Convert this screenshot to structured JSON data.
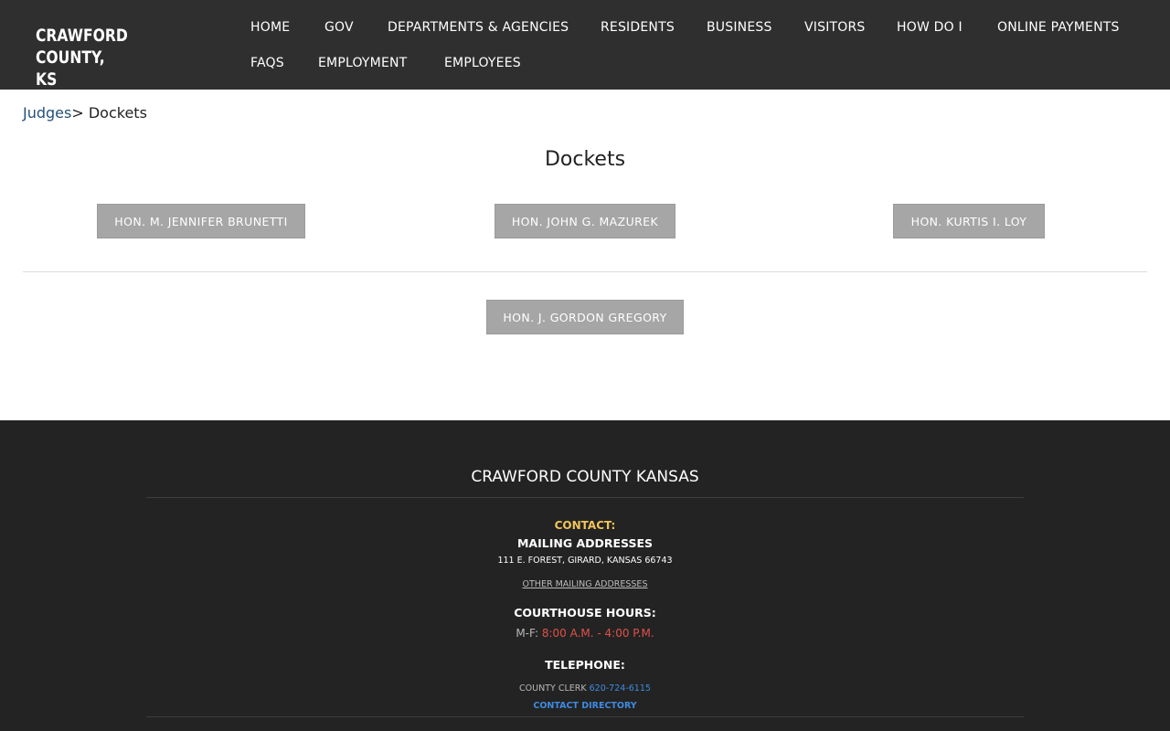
{
  "site": {
    "logo_line1": "CRAWFORD COUNTY,",
    "logo_line2": "KS"
  },
  "nav": {
    "items": [
      {
        "label": "HOME"
      },
      {
        "label": "GOV"
      },
      {
        "label": "DEPARTMENTS & AGENCIES"
      },
      {
        "label": "RESIDENTS"
      },
      {
        "label": "BUSINESS"
      },
      {
        "label": "VISITORS"
      },
      {
        "label": "HOW DO I"
      },
      {
        "label": "ONLINE PAYMENTS"
      },
      {
        "label": "FAQS"
      },
      {
        "label": "EMPLOYMENT"
      },
      {
        "label": "EMPLOYEES"
      }
    ]
  },
  "breadcrumb": {
    "parent": "Judges",
    "separator": ">",
    "current": " Dockets"
  },
  "page": {
    "title": "Dockets"
  },
  "judges": [
    {
      "label": "HON. M. JENNIFER BRUNETTI"
    },
    {
      "label": "HON. JOHN G. MAZUREK"
    },
    {
      "label": "HON. KURTIS I. LOY"
    },
    {
      "label": "HON. J. GORDON GREGORY"
    }
  ],
  "footer": {
    "title": "CRAWFORD COUNTY KANSAS",
    "contact_label": "CONTACT:",
    "mailing_heading": "MAILING ADDRESSES",
    "mailing_address": "111 E. FOREST, GIRARD, KANSAS 66743",
    "other_addresses_link": "OTHER MAILING ADDRESSES",
    "hours_heading": "COURTHOUSE HOURS:",
    "hours_days": "M-F: ",
    "hours_time": "8:00 A.M. - 4:00 P.M.",
    "telephone_heading": "TELEPHONE:",
    "clerk_label": "COUNTY CLERK ",
    "clerk_phone": "620-724-6115",
    "directory_link": "CONTACT DIRECTORY"
  },
  "colors": {
    "header_bg": "#2f2f2f",
    "footer_bg": "#232323",
    "button_bg": "#a6a6a6",
    "link_blue": "#24507a",
    "contact_gold": "#f0c45a",
    "hours_red": "#e0514a",
    "footer_link_blue": "#3f8be0"
  }
}
